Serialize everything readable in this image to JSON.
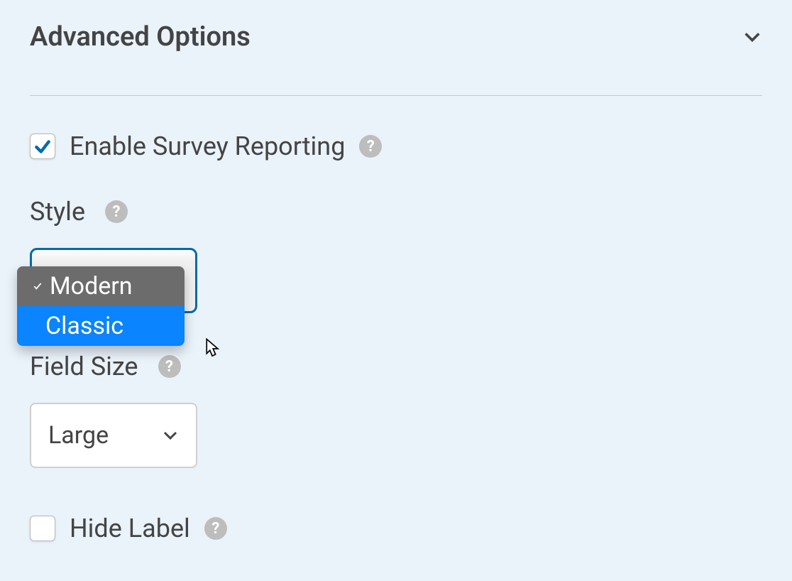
{
  "section": {
    "title": "Advanced Options"
  },
  "enableSurvey": {
    "label": "Enable Survey Reporting",
    "checked": true
  },
  "style": {
    "label": "Style",
    "options": [
      {
        "label": "Modern",
        "selected": true
      },
      {
        "label": "Classic",
        "highlighted": true
      }
    ]
  },
  "fieldSize": {
    "label": "Field Size",
    "value": "Large"
  },
  "hideLabel": {
    "label": "Hide Label",
    "checked": false
  }
}
